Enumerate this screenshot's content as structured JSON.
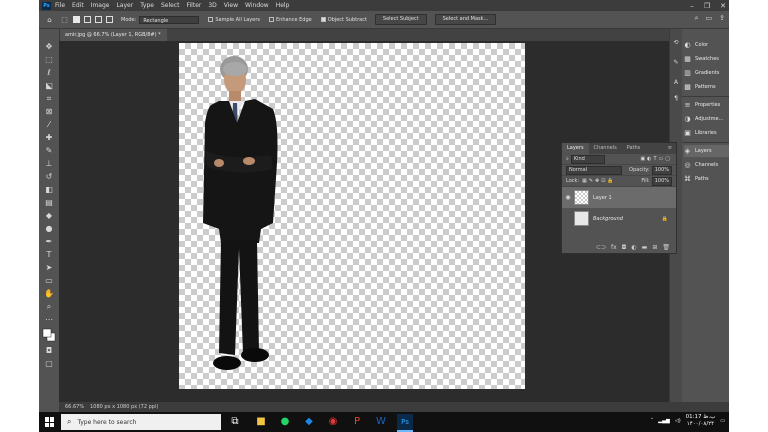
{
  "menubar": {
    "logo": "Ps",
    "items": [
      "File",
      "Edit",
      "Image",
      "Layer",
      "Type",
      "Select",
      "Filter",
      "3D",
      "View",
      "Window",
      "Help"
    ],
    "window_controls": [
      "–",
      "❐",
      "✕"
    ]
  },
  "options": {
    "mode_label": "Mode:",
    "mode_value": "Rectangle",
    "sample_all_layers": "Sample All Layers",
    "enhance_edge": "Enhance Edge",
    "object_subtract": "Object Subtract",
    "select_subject": "Select Subject",
    "select_and_mask": "Select and Mask..."
  },
  "document": {
    "tab_title": "amir.jpg @ 66.7% (Layer 1, RGB/8#) *"
  },
  "status": {
    "zoom": "66.67%",
    "info": "1080 px x 1080 px (72 ppi)"
  },
  "right_panel": {
    "items": [
      {
        "label": "Color",
        "icon": "color-icon"
      },
      {
        "label": "Swatches",
        "icon": "swatches-icon"
      },
      {
        "label": "Gradients",
        "icon": "gradients-icon"
      },
      {
        "label": "Patterns",
        "icon": "patterns-icon"
      },
      {
        "label": "Properties",
        "icon": "properties-icon"
      },
      {
        "label": "Adjustme...",
        "icon": "adjustments-icon"
      },
      {
        "label": "Libraries",
        "icon": "libraries-icon"
      },
      {
        "label": "Layers",
        "icon": "layers-icon"
      },
      {
        "label": "Channels",
        "icon": "channels-icon"
      },
      {
        "label": "Paths",
        "icon": "paths-icon"
      }
    ]
  },
  "layers_panel": {
    "tabs": [
      "Layers",
      "Channels",
      "Paths"
    ],
    "kind": "Kind",
    "blend_mode": "Normal",
    "opacity_label": "Opacity:",
    "opacity_value": "100%",
    "lock_label": "Lock:",
    "fill_label": "Fill:",
    "fill_value": "100%",
    "layers": [
      {
        "name": "Layer 1",
        "active": true
      },
      {
        "name": "Background",
        "active": false
      }
    ]
  },
  "taskbar": {
    "search_placeholder": "Type here to search",
    "time": "01:17 ب.ظ",
    "date": "۱۴۰۰/۰۸/۲۴"
  },
  "colors": {
    "app_bg": "#535353",
    "menubar": "#3c3c3c",
    "canvas_bg": "#2c2c2c",
    "accent": "#31a8ff"
  }
}
